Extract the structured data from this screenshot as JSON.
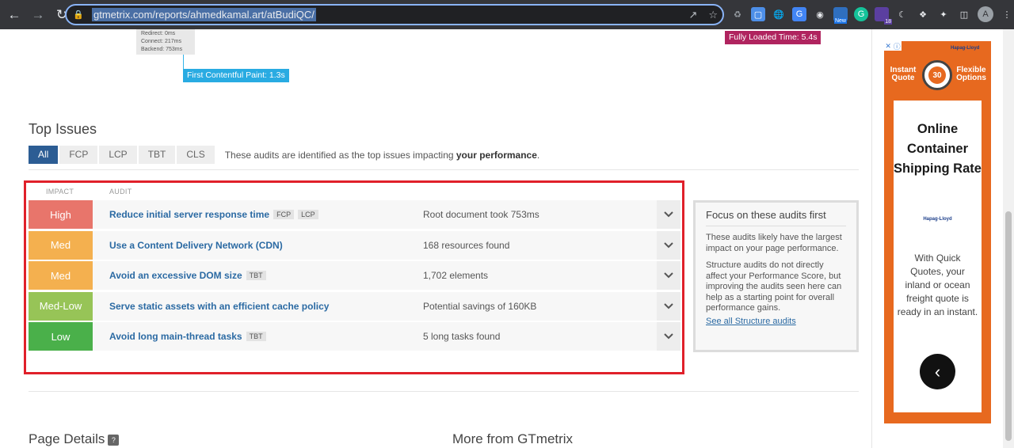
{
  "browser": {
    "url": "gtmetrix.com/reports/ahmedkamal.art/atBudiQC/",
    "extension_badge": "18",
    "new_badge": "New",
    "profile_initial": "A"
  },
  "waterfall": {
    "timing": [
      "Redirect: 0ms",
      "Connect: 217ms",
      "Backend: 753ms"
    ],
    "fcp_label": "First Contentful Paint: 1.3s",
    "flt_label": "Fully Loaded Time: 5.4s"
  },
  "top_issues": {
    "title": "Top Issues",
    "filters": [
      "All",
      "FCP",
      "LCP",
      "TBT",
      "CLS"
    ],
    "note_prefix": "These audits are identified as the top issues impacting ",
    "note_bold": "your performance",
    "note_suffix": ".",
    "col_impact": "IMPACT",
    "col_audit": "AUDIT",
    "rows": [
      {
        "impact": "High",
        "color": "#e8756b",
        "audit": "Reduce initial server response time",
        "tags": [
          "FCP",
          "LCP"
        ],
        "result": "Root document took 753ms"
      },
      {
        "impact": "Med",
        "color": "#f4b04f",
        "audit": "Use a Content Delivery Network (CDN)",
        "tags": [],
        "result": "168 resources found"
      },
      {
        "impact": "Med",
        "color": "#f4b04f",
        "audit": "Avoid an excessive DOM size",
        "tags": [
          "TBT"
        ],
        "result": "1,702 elements"
      },
      {
        "impact": "Med-Low",
        "color": "#97c457",
        "audit": "Serve static assets with an efficient cache policy",
        "tags": [],
        "result": "Potential savings of 160KB"
      },
      {
        "impact": "Low",
        "color": "#4ab04a",
        "audit": "Avoid long main-thread tasks",
        "tags": [
          "TBT"
        ],
        "result": "5 long tasks found"
      }
    ]
  },
  "focus": {
    "title": "Focus on these audits first",
    "p1": "These audits likely have the largest impact on your page performance.",
    "p2": "Structure audits do not directly affect your Performance Score, but improving the audits seen here can help as a starting point for overall performance gains.",
    "link": "See all Structure audits"
  },
  "bottom": {
    "page_details": "Page Details",
    "help": "?",
    "more_from": "More from GTmetrix"
  },
  "ad": {
    "left_text": "Instant Quote",
    "right_text": "Flexible Options",
    "clock_number": "30",
    "headline": "Online Container Shipping Rate",
    "body": "With Quick Quotes, your inland or ocean freight quote is ready in an instant.",
    "brand": "Hapag-Lloyd"
  }
}
